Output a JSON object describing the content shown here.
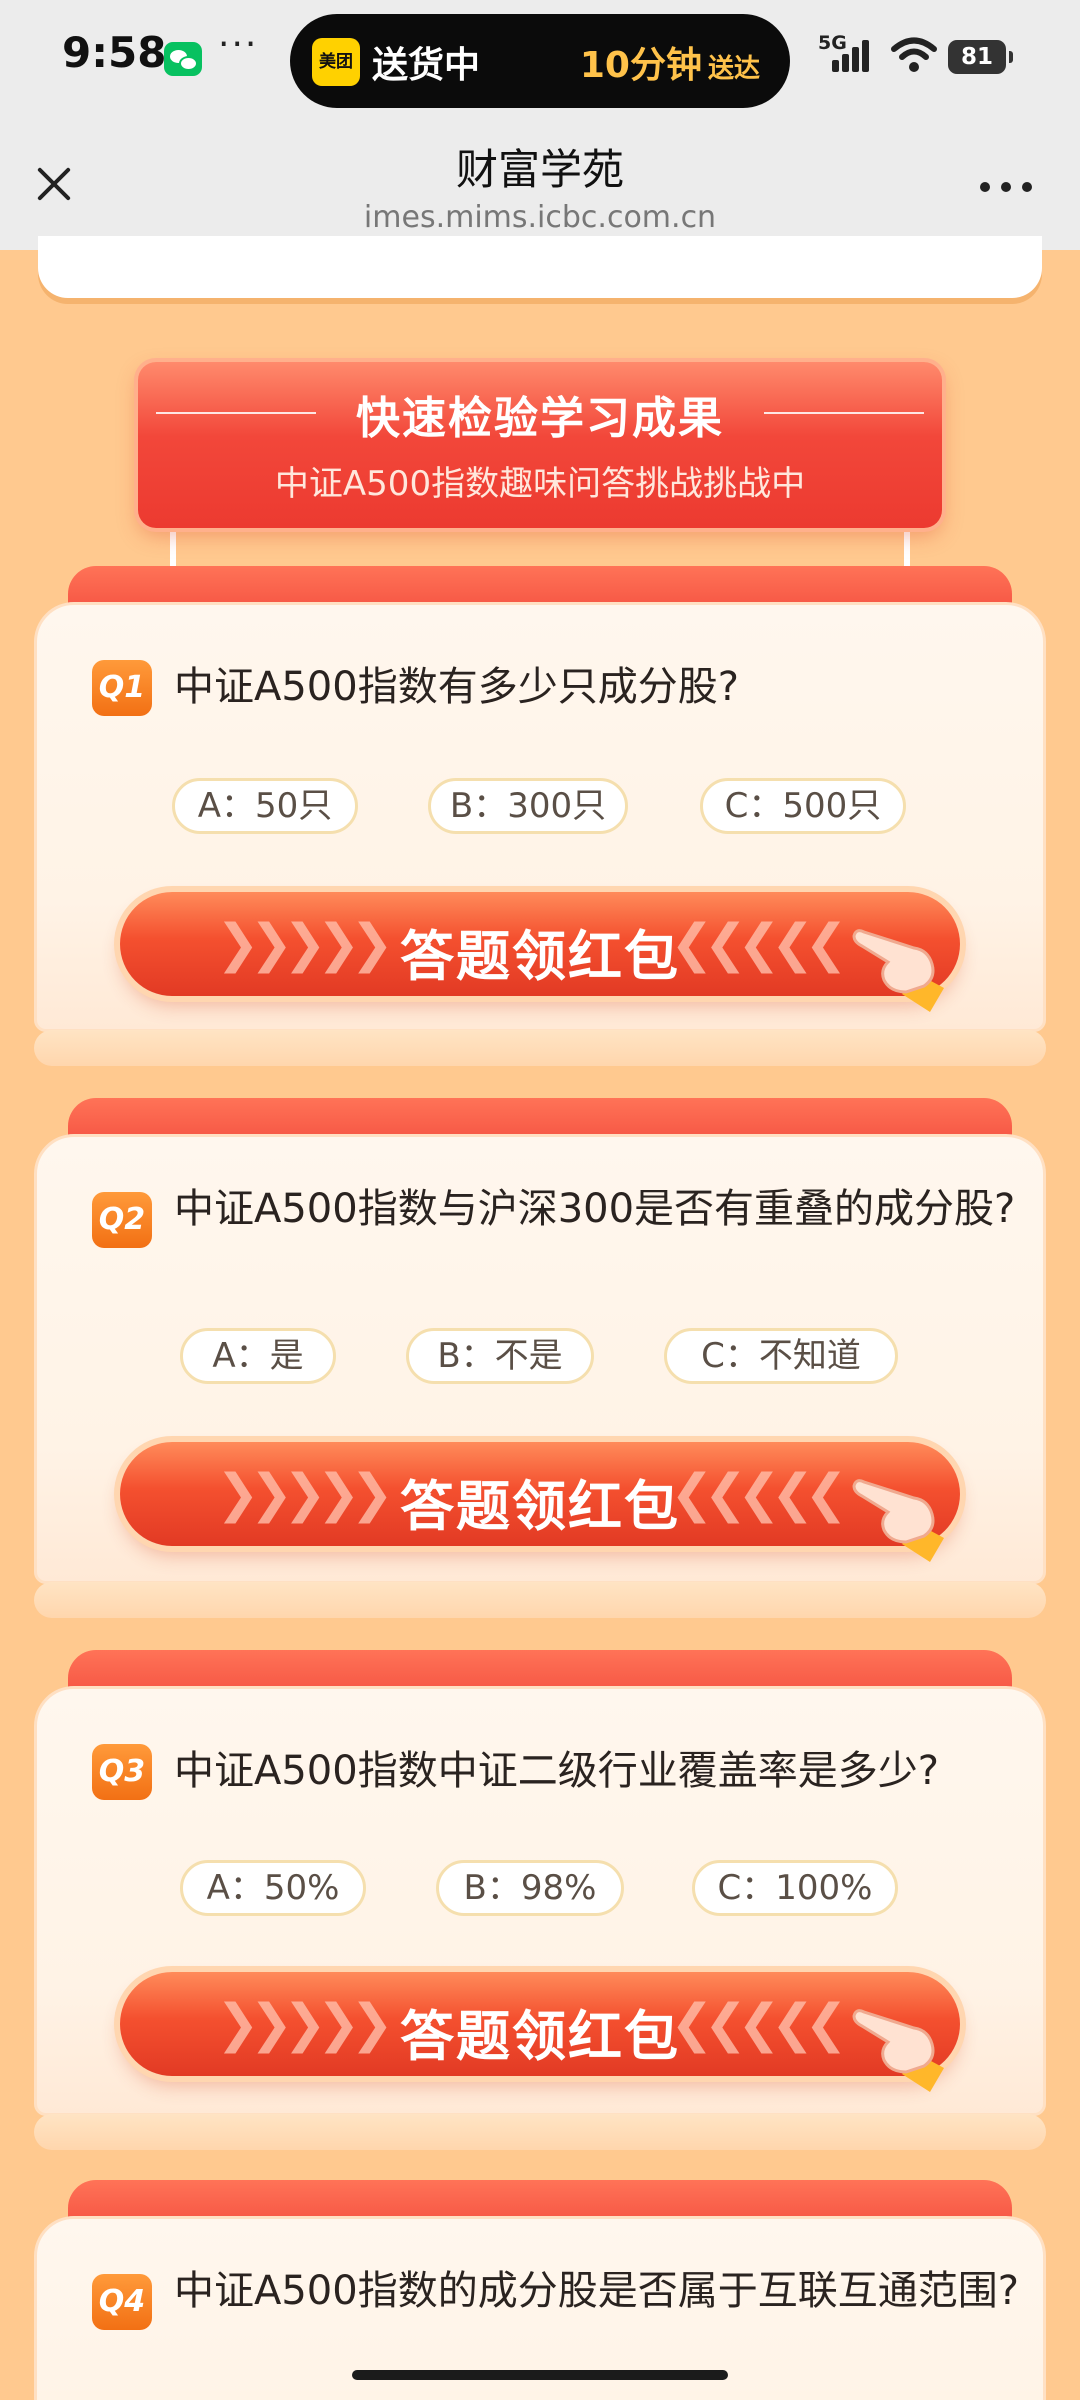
{
  "status_bar": {
    "time": "9:58",
    "more": "···",
    "live_activity": {
      "brand": "美团",
      "status": "送货中",
      "eta": "10分钟",
      "eta_suffix": "送达"
    },
    "network": "5G",
    "battery": "81"
  },
  "nav": {
    "title": "财富学苑",
    "url": "imes.mims.icbc.com.cn"
  },
  "banner": {
    "title": "快速检验学习成果",
    "subtitle": "中证A500指数趣味问答挑战挑战中"
  },
  "questions": [
    {
      "badge": "Q1",
      "text": "中证A500指数有多少只成分股?",
      "options": [
        "A：50只",
        "B：300只",
        "C：500只"
      ],
      "button": "答题领红包"
    },
    {
      "badge": "Q2",
      "text": "中证A500指数与沪深300是否有重叠的成分股?",
      "options": [
        "A：是",
        "B：不是",
        "C：不知道"
      ],
      "button": "答题领红包"
    },
    {
      "badge": "Q3",
      "text": "中证A500指数中证二级行业覆盖率是多少?",
      "options": [
        "A：50%",
        "B：98%",
        "C：100%"
      ],
      "button": "答题领红包"
    },
    {
      "badge": "Q4",
      "text": "中证A500指数的成分股是否属于互联互通范围?"
    }
  ],
  "icons": {
    "close": "close-icon",
    "more": "more-horizontal-icon",
    "pointer": "pointing-hand-icon"
  },
  "colors": {
    "page_bg": "#ffc98f",
    "accent_red": "#f24a3c",
    "badge_orange": "#f27014"
  }
}
